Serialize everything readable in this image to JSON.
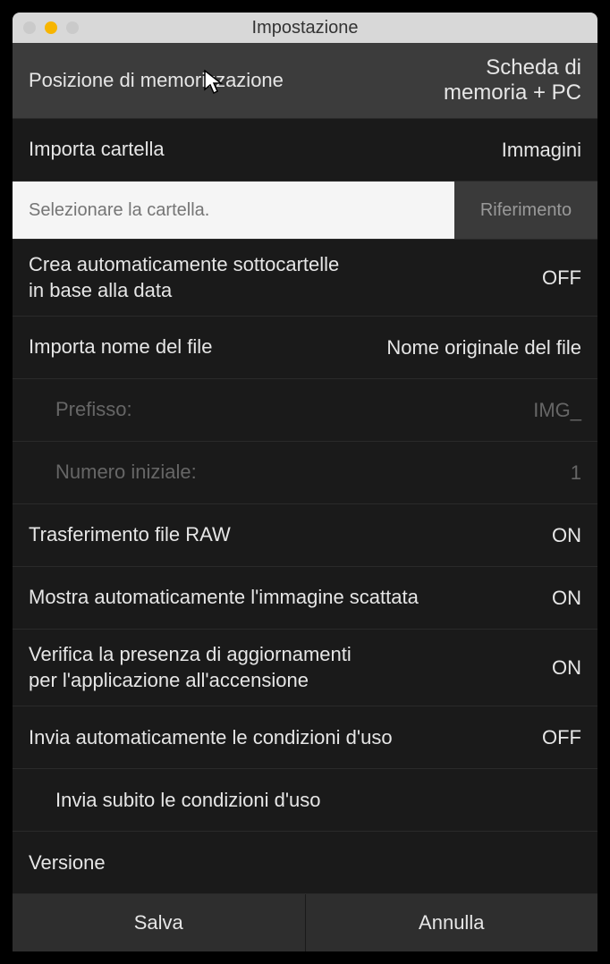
{
  "titlebar": {
    "title": "Impostazione"
  },
  "rows": {
    "storage_position": {
      "label": "Posizione di memorizzazione",
      "value": "Scheda di\nmemoria + PC"
    },
    "import_folder": {
      "label": "Importa cartella",
      "value": "Immagini"
    },
    "folder_placeholder": "Selezionare la cartella.",
    "reference_btn": "Riferimento",
    "auto_subfolders": {
      "label": "Crea automaticamente sottocartelle\nin base alla data",
      "value": "OFF"
    },
    "import_filename": {
      "label": "Importa nome del file",
      "value": "Nome originale del file"
    },
    "prefix": {
      "label": "Prefisso:",
      "value": "IMG_"
    },
    "start_number": {
      "label": "Numero iniziale:",
      "value": "1"
    },
    "raw_transfer": {
      "label": "Trasferimento file RAW",
      "value": "ON"
    },
    "auto_show": {
      "label": "Mostra automaticamente l'immagine scattata",
      "value": "ON"
    },
    "check_updates": {
      "label": "Verifica la presenza di aggiornamenti\nper l'applicazione all'accensione",
      "value": "ON"
    },
    "auto_send_cond": {
      "label": "Invia automaticamente le condizioni d'uso",
      "value": "OFF"
    },
    "send_now_cond": {
      "label": "Invia subito le condizioni d'uso"
    },
    "version": {
      "label": "Versione"
    }
  },
  "footer": {
    "save": "Salva",
    "cancel": "Annulla"
  }
}
